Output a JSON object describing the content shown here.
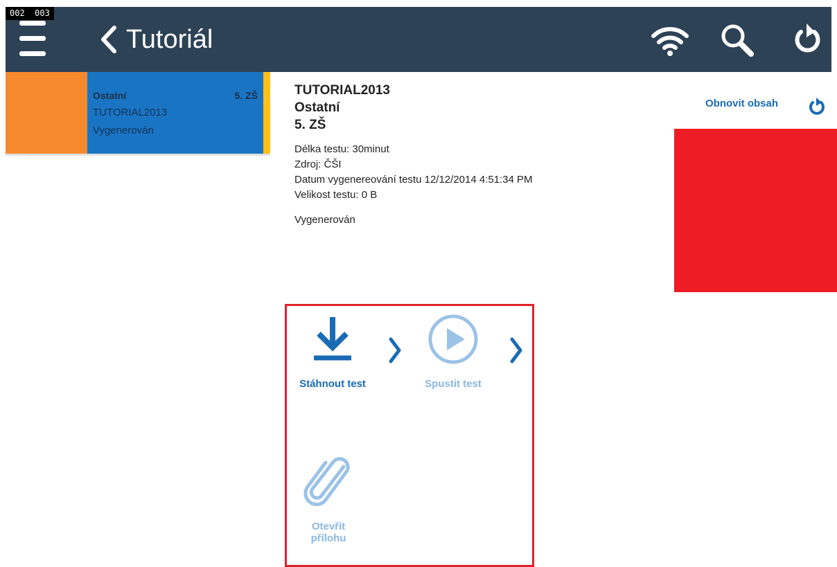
{
  "header": {
    "counters": "002  003",
    "back_label": "Tutoriál",
    "bg_color": "#2e4255"
  },
  "tile": {
    "category": "Ostatní",
    "grade": "5. ZŠ",
    "code": "TUTORIAL2013",
    "status": "Vygenerován",
    "colors": {
      "left": "#f58a2d",
      "main": "#1a74c4",
      "edge": "#ffc01a"
    }
  },
  "detail": {
    "title": "TUTORIAL2013",
    "category": "Ostatní",
    "grade": "5. ZŠ",
    "length": "Délka testu: 30minut",
    "source": "Zdroj: ČŠI",
    "generated_date": "Datum vygenereování testu 12/12/2014 4:51:34 PM",
    "size": "Velikost testu: 0 B",
    "status": "Vygenerován"
  },
  "refresh": {
    "label": "Obnovit obsah",
    "icon": "refresh-icon"
  },
  "actions": {
    "download_label": "Stáhnout test",
    "start_label": "Spustit test",
    "attachment_label_line1": "Otevřít",
    "attachment_label_line2": "přílohu",
    "icons": [
      "download-icon",
      "play-icon",
      "paperclip-icon",
      "chevron-right-icon"
    ]
  }
}
